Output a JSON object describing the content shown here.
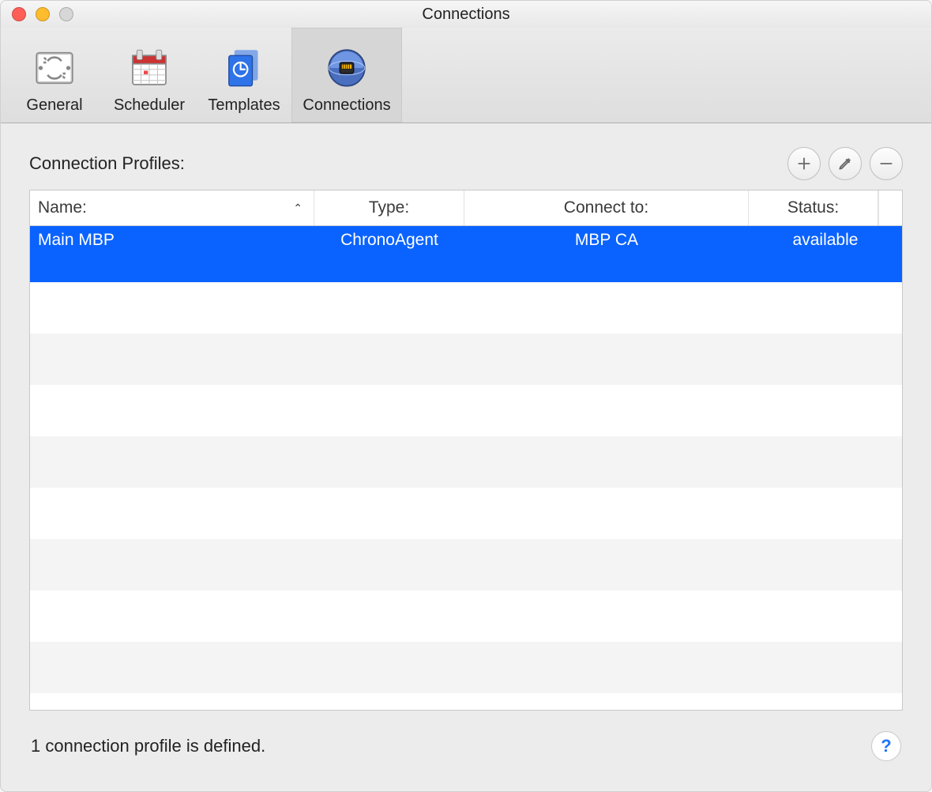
{
  "window": {
    "title": "Connections"
  },
  "toolbar": {
    "items": [
      {
        "label": "General"
      },
      {
        "label": "Scheduler"
      },
      {
        "label": "Templates"
      },
      {
        "label": "Connections"
      }
    ],
    "selected_index": 3
  },
  "section": {
    "title": "Connection Profiles:"
  },
  "table": {
    "columns": {
      "name": "Name:",
      "type": "Type:",
      "connect_to": "Connect to:",
      "status": "Status:"
    },
    "sort_column": "name",
    "sort_direction": "asc",
    "rows": [
      {
        "name": "Main MBP",
        "type": "ChronoAgent",
        "connect_to": "MBP CA",
        "status": "available",
        "selected": true
      }
    ]
  },
  "footer": {
    "status": "1 connection profile is defined."
  }
}
